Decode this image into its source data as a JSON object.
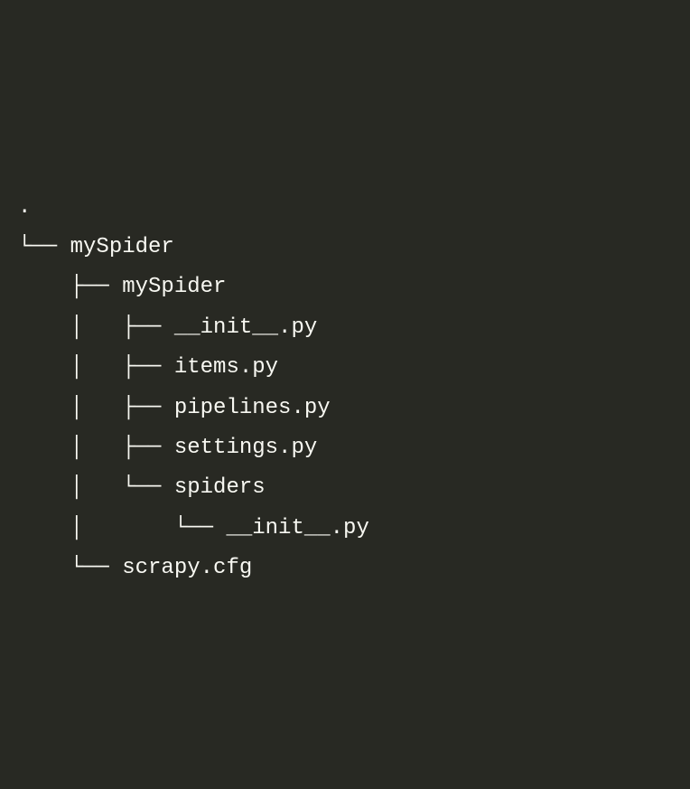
{
  "tree": {
    "lines": [
      ".",
      "└── mySpider",
      "    ├── mySpider",
      "    │   ├── __init__.py",
      "    │   ├── items.py",
      "    │   ├── pipelines.py",
      "    │   ├── settings.py",
      "    │   └── spiders",
      "    │       └── __init__.py",
      "    └── scrapy.cfg"
    ]
  }
}
